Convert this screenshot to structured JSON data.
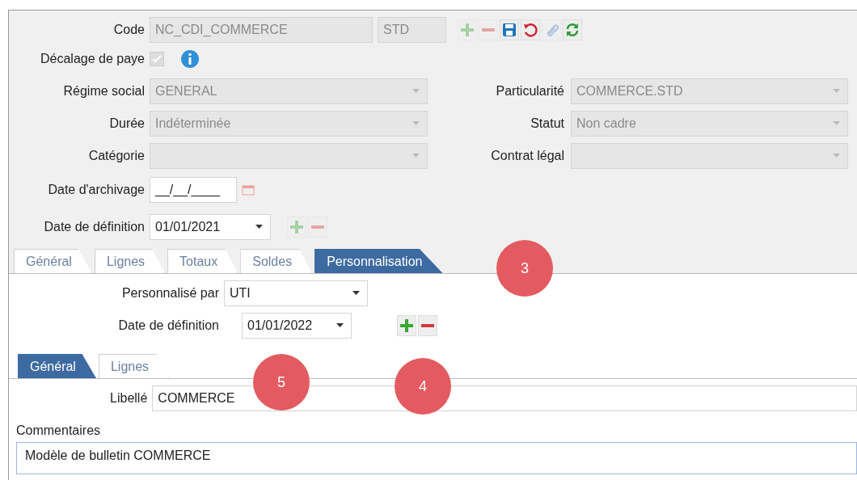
{
  "header": {
    "code_label": "Code",
    "code": "NC_CDI_COMMERCE",
    "variant": "STD",
    "buttons": [
      {
        "kind": "add",
        "disabled": true
      },
      {
        "kind": "remove",
        "disabled": true
      },
      {
        "kind": "save",
        "disabled": false
      },
      {
        "kind": "undo",
        "disabled": false
      },
      {
        "kind": "attach",
        "disabled": true
      },
      {
        "kind": "refresh",
        "disabled": false
      }
    ]
  },
  "pay_offset": {
    "label": "Décalage de paye",
    "checked": true,
    "disabled": true
  },
  "field_rows": [
    {
      "left": {
        "label": "Régime social",
        "value": "GENERAL",
        "disabled": true
      },
      "right": {
        "label": "Particularité",
        "value": "COMMERCE.STD",
        "disabled": true
      }
    },
    {
      "left": {
        "label": "Durée",
        "value": "Indéterminée",
        "disabled": true
      },
      "right": {
        "label": "Statut",
        "value": "Non cadre",
        "disabled": true
      }
    },
    {
      "left": {
        "label": "Catégorie",
        "disabled": true
      },
      "right": {
        "label": "Contrat légal",
        "disabled": true
      }
    }
  ],
  "archive_date": {
    "label": "Date d'archivage",
    "value": "__/__/____"
  },
  "definition_date": {
    "label": "Date de définition",
    "value": "01/01/2021",
    "add_disabled": true,
    "remove_disabled": true
  },
  "tabs": [
    {
      "label": "Général",
      "selected": false
    },
    {
      "label": "Lignes",
      "selected": false
    },
    {
      "label": "Totaux",
      "selected": false
    },
    {
      "label": "Soldes",
      "selected": false
    },
    {
      "label": "Personnalisation",
      "selected": true
    }
  ],
  "personalization": {
    "by_label": "Personnalisé par",
    "by_value": "UTI",
    "date_label": "Date de définition",
    "date_value": "01/01/2022",
    "add_disabled": false,
    "remove_disabled": false
  },
  "subtabs": [
    {
      "label": "Général",
      "selected": true
    },
    {
      "label": "Lignes",
      "selected": false
    }
  ],
  "libelle": {
    "label": "Libellé",
    "value": "COMMERCE"
  },
  "comments": {
    "label": "Commentaires",
    "value": "Modèle de bulletin COMMERCE"
  },
  "callouts": [
    "3",
    "5",
    "4"
  ]
}
